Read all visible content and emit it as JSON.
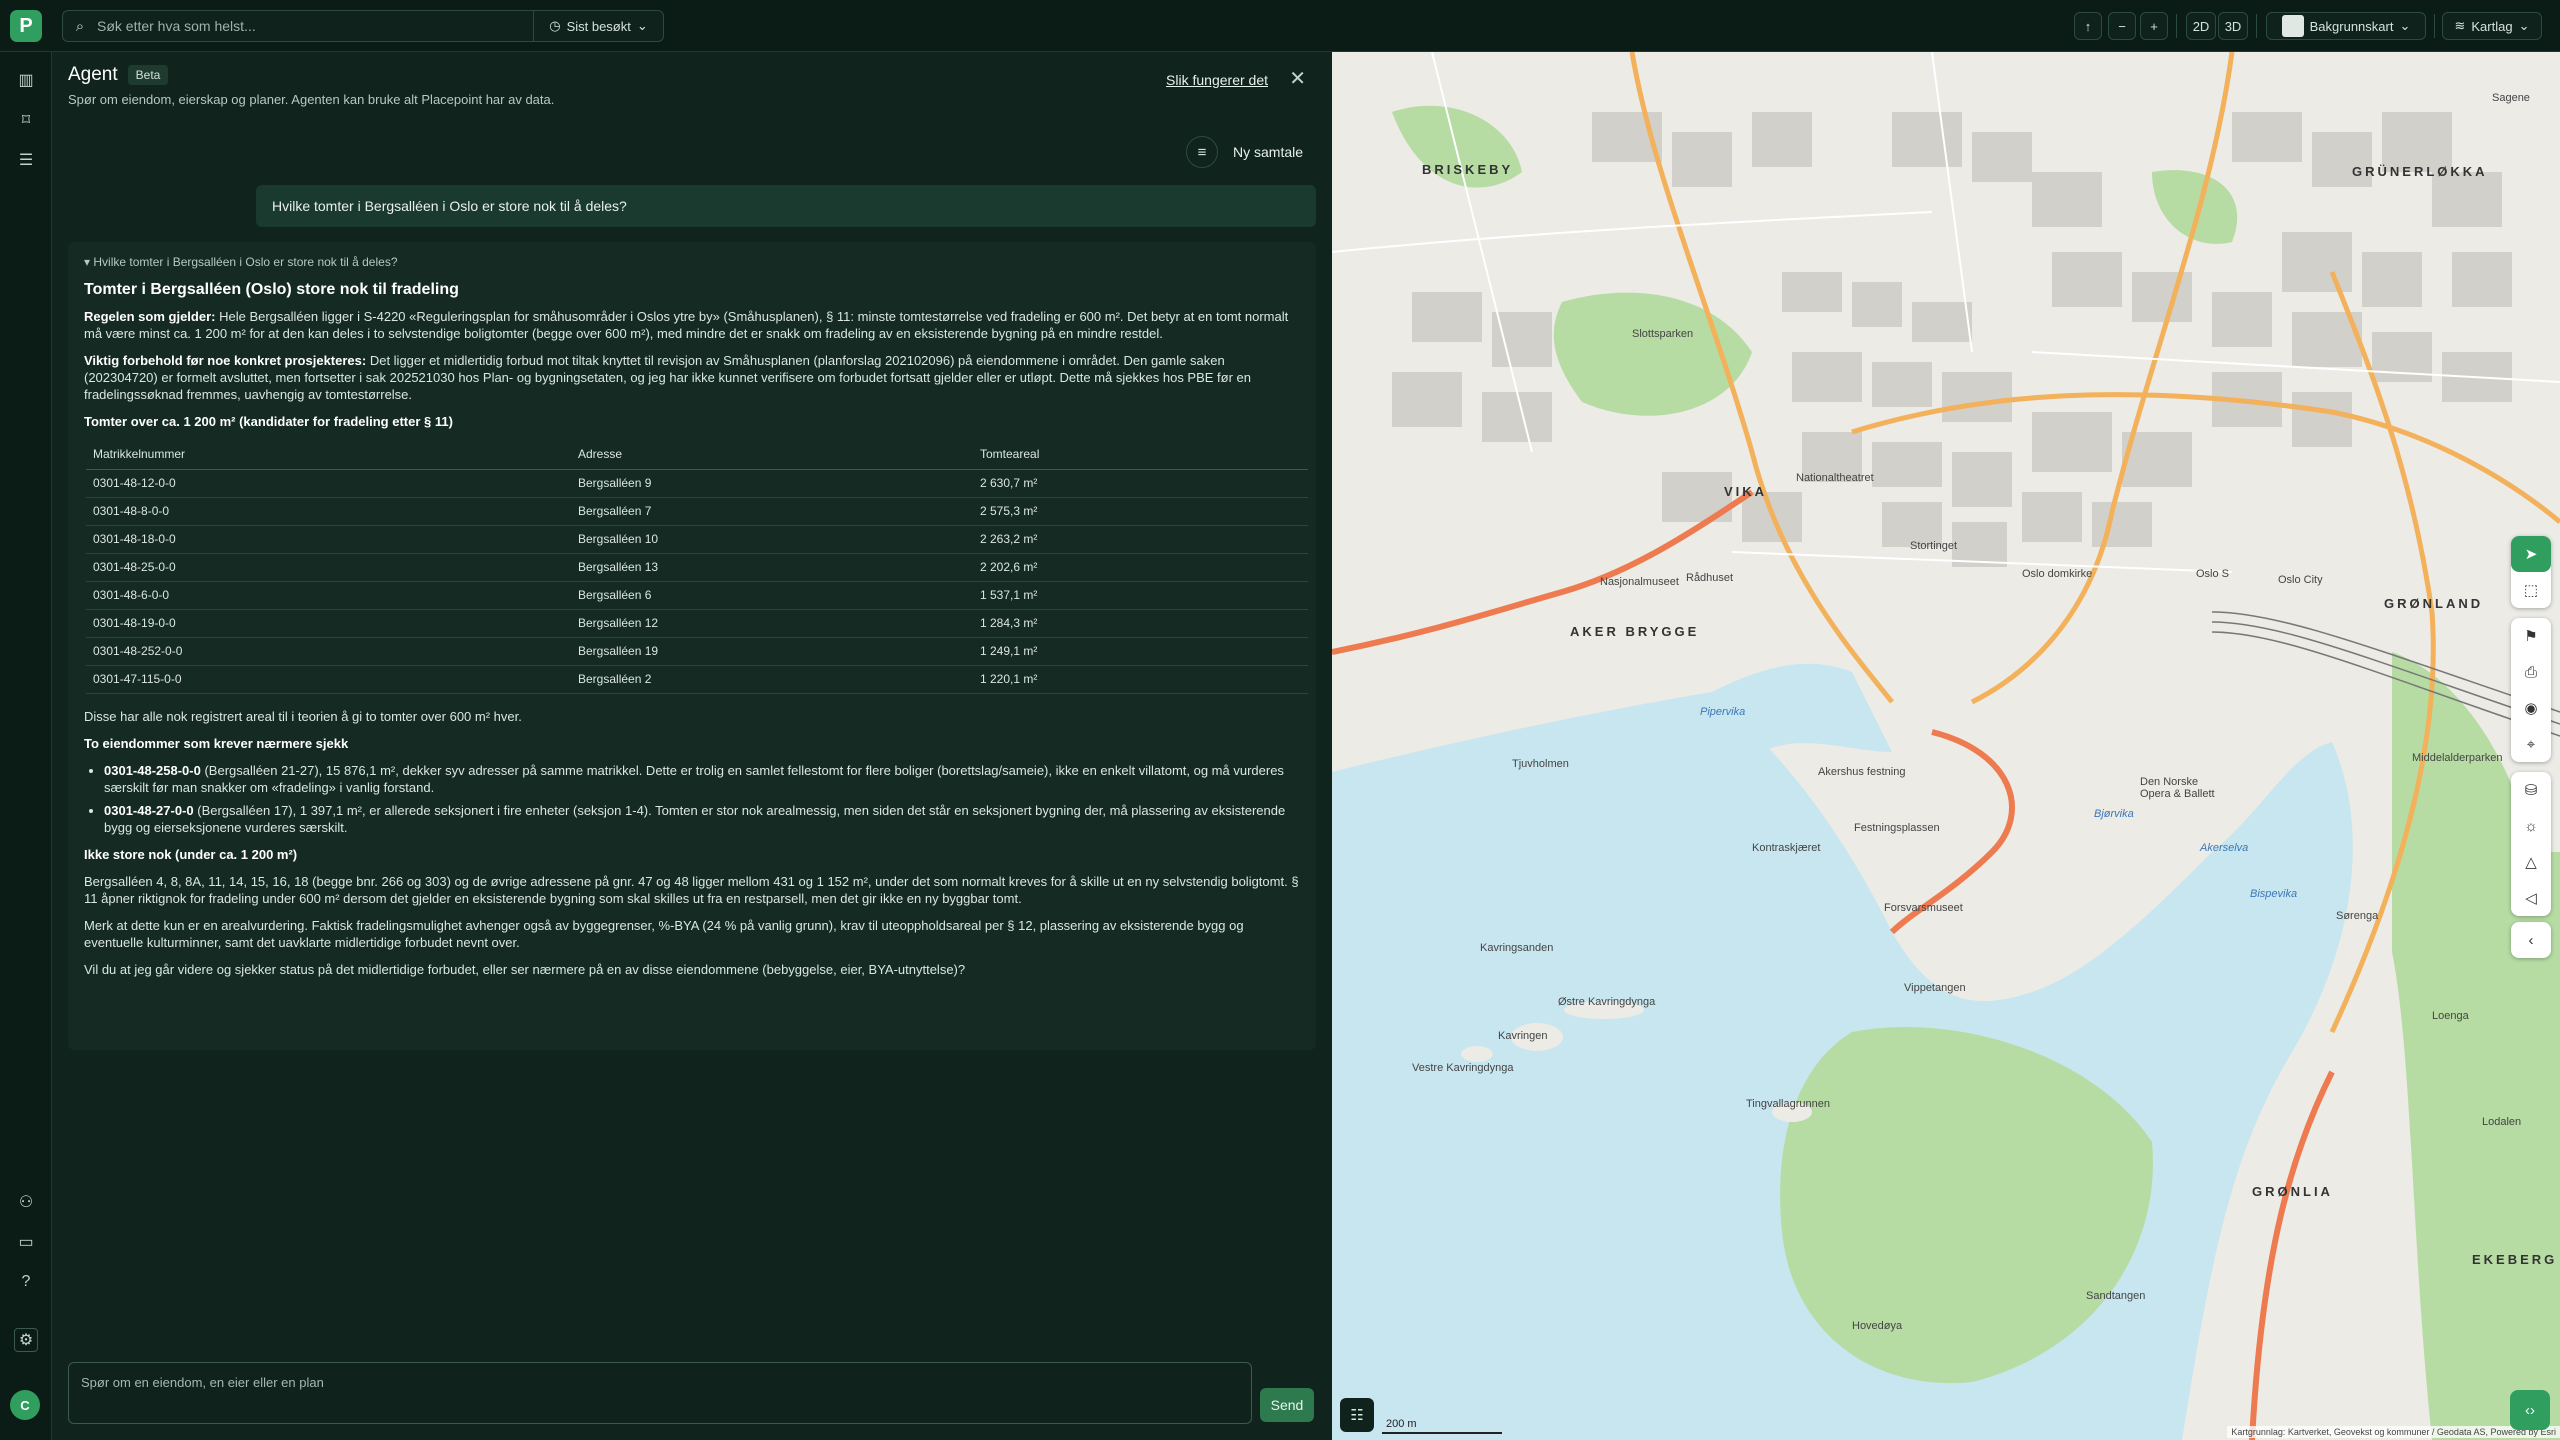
{
  "logo": {
    "letter": "P"
  },
  "search": {
    "placeholder": "Søk etter hva som helst...",
    "recent_label": "Sist besøkt"
  },
  "map_controls": {
    "zoom_out": "−",
    "zoom_in": "+",
    "mode_2d": "2D",
    "mode_3d": "3D",
    "basemap_label": "Bakgrunnskart",
    "layers_label": "Kartlag"
  },
  "agent": {
    "title": "Agent",
    "badge": "Beta",
    "subtitle": "Spør om eiendom, eierskap og planer. Agenten kan bruke alt Placepoint har av data.",
    "how_link": "Slik fungerer det",
    "new_chat": "Ny samtale",
    "user_question": "Hvilke tomter i Bergsalléen i Oslo er store nok til å deles?"
  },
  "answer": {
    "summary": "Hvilke tomter i Bergsalléen i Oslo er store nok til å deles?",
    "heading": "Tomter i Bergsalléen (Oslo) store nok til fradeling",
    "rule_label": "Regelen som gjelder:",
    "rule_text": " Hele Bergsalléen ligger i S-4220 «Reguleringsplan for småhusområder i Oslos ytre by» (Småhusplanen), § 11: minste tomtestørrelse ved fradeling er 600 m². Det betyr at en tomt normalt må være minst ca. 1 200 m² for at den kan deles i to selvstendige boligtomter (begge over 600 m²), med mindre det er snakk om fradeling av en eksisterende bygning på en mindre restdel.",
    "caveat_label": "Viktig forbehold før noe konkret prosjekteres:",
    "caveat_text": " Det ligger et midlertidig forbud mot tiltak knyttet til revisjon av Småhusplanen (planforslag 202102096) på eiendommene i området. Den gamle saken (202304720) er formelt avsluttet, men fortsetter i sak 202521030 hos Plan- og bygningsetaten, og jeg har ikke kunnet verifisere om forbudet fortsatt gjelder eller er utløpt. Dette må sjekkes hos PBE før en fradelingssøknad fremmes, uavhengig av tomtestørrelse.",
    "table_heading": "Tomter over ca. 1 200 m² (kandidater for fradeling etter § 11)",
    "table_headers": [
      "Matrikkelnummer",
      "Adresse",
      "Tomteareal"
    ],
    "table_rows": [
      [
        "0301-48-12-0-0",
        "Bergsalléen 9",
        "2 630,7 m²"
      ],
      [
        "0301-48-8-0-0",
        "Bergsalléen 7",
        "2 575,3 m²"
      ],
      [
        "0301-48-18-0-0",
        "Bergsalléen 10",
        "2 263,2 m²"
      ],
      [
        "0301-48-25-0-0",
        "Bergsalléen 13",
        "2 202,6 m²"
      ],
      [
        "0301-48-6-0-0",
        "Bergsalléen 6",
        "1 537,1 m²"
      ],
      [
        "0301-48-19-0-0",
        "Bergsalléen 12",
        "1 284,3 m²"
      ],
      [
        "0301-48-252-0-0",
        "Bergsalléen 19",
        "1 249,1 m²"
      ],
      [
        "0301-47-115-0-0",
        "Bergsalléen 2",
        "1 220,1 m²"
      ]
    ],
    "after_table": "Disse har alle nok registrert areal til i teorien å gi to tomter over 600 m² hver.",
    "closer_heading": "To eiendommer som krever nærmere sjekk",
    "closer_items": [
      {
        "id": "0301-48-258-0-0",
        "text": " (Bergsalléen 21-27), 15 876,1 m², dekker syv adresser på samme matrikkel. Dette er trolig en samlet fellestomt for flere boliger (borettslag/sameie), ikke en enkelt villatomt, og må vurderes særskilt før man snakker om «fradeling» i vanlig forstand."
      },
      {
        "id": "0301-48-27-0-0",
        "text": " (Bergsalléen 17), 1 397,1 m², er allerede seksjonert i fire enheter (seksjon 1-4). Tomten er stor nok arealmessig, men siden det står en seksjonert bygning der, må plassering av eksisterende bygg og eierseksjonene vurderes særskilt."
      }
    ],
    "small_heading": "Ikke store nok (under ca. 1 200 m²)",
    "small_text": "Bergsalléen 4, 8, 8A, 11, 14, 15, 16, 18 (begge bnr. 266 og 303) og de øvrige adressene på gnr. 47 og 48 ligger mellom 431 og 1 152 m², under det som normalt kreves for å skille ut en ny selvstendig boligtomt. § 11 åpner riktignok for fradeling under 600 m² dersom det gjelder en eksisterende bygning som skal skilles ut fra en restparsell, men det gir ikke en ny byggbar tomt.",
    "note_text": "Merk at dette kun er en arealvurdering. Faktisk fradelingsmulighet avhenger også av byggegrenser, %-BYA (24 % på vanlig grunn), krav til uteoppholdsareal per § 12, plassering av eksisterende bygg og eventuelle kulturminner, samt det uavklarte midlertidige forbudet nevnt over.",
    "followup": "Vil du at jeg går videre og sjekker status på det midlertidige forbudet, eller ser nærmere på en av disse eiendommene (bebyggelse, eier, BYA-utnyttelse)?"
  },
  "composer": {
    "placeholder": "Spør om en eiendom, en eier eller en plan",
    "send_label": "Send"
  },
  "user": {
    "initial": "C"
  },
  "map": {
    "labels": [
      "BRISKEBY",
      "GRÜNERLØKKA",
      "VIKA",
      "AKER BRYGGE",
      "GRØNLAND",
      "GRØNLIA",
      "EKEBERG",
      "Slottsparken",
      "Nationaltheatret",
      "Oslo S",
      "Oslo City",
      "Hovedøya",
      "Kavringen",
      "Østre Kavringdynga",
      "Vestre Kavringdynga",
      "Tingvallagrunnen",
      "Sandtangen",
      "Pipervika",
      "Bjørvika",
      "Akerselva",
      "Bispevika",
      "Akershus festning",
      "Kavringsanden",
      "Tjuvholmen",
      "Rådhuset",
      "Stortinget",
      "Oslo domkirke",
      "Nasjonalmuseet",
      "Festningsplassen",
      "Forsvarsmuseet",
      "Vippetangen",
      "Den Norske Opera & Ballett",
      "Sørenga",
      "Middelalderparken",
      "Kontraskjæret",
      "Lodalen",
      "Loenga",
      "Sagene"
    ],
    "scale": "200 m",
    "attribution": "Kartgrunnlag: Kartverket, Geovekst og kommuner / Geodata AS, Powered by Esri"
  },
  "colors": {
    "accent": "#2f9e5f",
    "panel_bg": "#10241d",
    "water": "#c8e6f0",
    "park": "#b6dca4"
  }
}
